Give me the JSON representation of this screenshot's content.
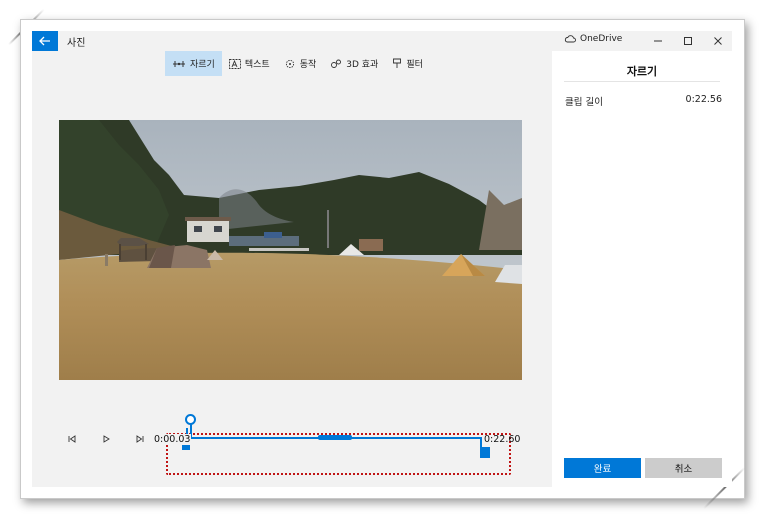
{
  "app": {
    "title": "사진"
  },
  "window": {
    "onedrive_label": "OneDrive"
  },
  "toolbar": {
    "items": [
      {
        "label": "자르기",
        "icon": "trim-icon",
        "active": true
      },
      {
        "label": "텍스트",
        "icon": "text-icon",
        "active": false
      },
      {
        "label": "동작",
        "icon": "motion-icon",
        "active": false
      },
      {
        "label": "3D 효과",
        "icon": "3d-effects-icon",
        "active": false
      },
      {
        "label": "필터",
        "icon": "filter-icon",
        "active": false
      }
    ]
  },
  "timeline": {
    "start_time": "0:00.03",
    "end_time": "0:22.60"
  },
  "panel": {
    "title": "자르기",
    "clip_length_label": "클립 길이",
    "clip_length_value": "0:22.56",
    "done_label": "완료",
    "cancel_label": "취소"
  },
  "colors": {
    "accent": "#0078d7",
    "toolbar_active": "#c4dff5",
    "highlight_box": "#c01515"
  }
}
